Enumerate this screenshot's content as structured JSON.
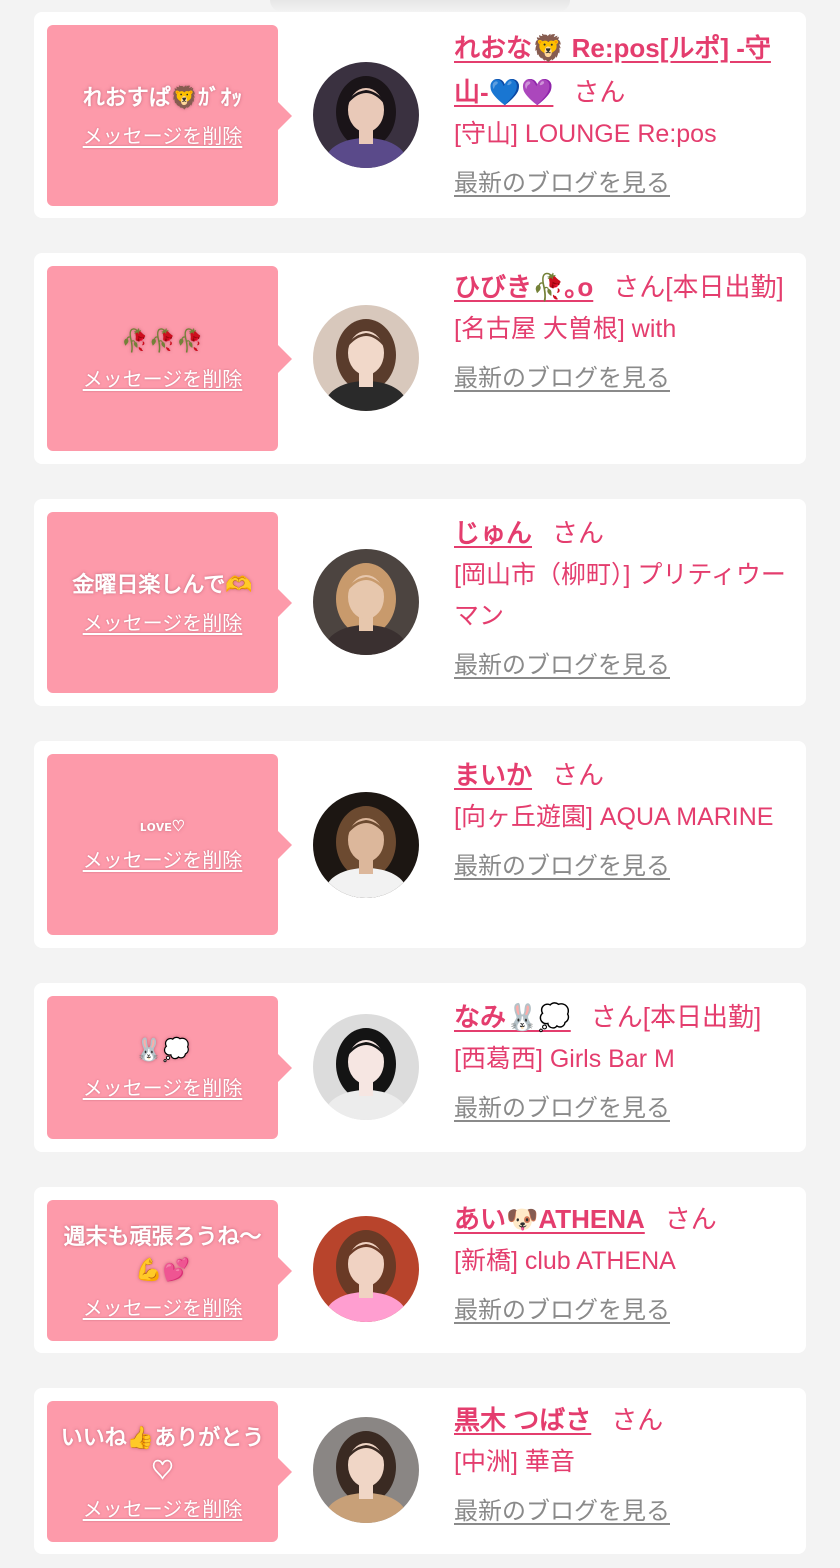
{
  "entries": [
    {
      "message": "れおすぱ🦁ｶﾞｵｯ",
      "delete_label": "メッセージを削除",
      "name": "れおな🦁 Re:pos[ルポ] -守山-💙💜",
      "honorific": "さん",
      "status": "",
      "shop": "[守山] LOUNGE Re:pos",
      "blog_label": "最新のブログを見る",
      "avatar_icon": "profile-photo-icon",
      "colors": {
        "bg": "#3a3140",
        "hair": "#1a1418",
        "skin": "#e9c9b8",
        "cloth": "#5a4a8a"
      }
    },
    {
      "message": "🥀🥀🥀",
      "delete_label": "メッセージを削除",
      "name": "ひびき🥀｡o",
      "honorific": "さん",
      "status": "[本日出勤]",
      "shop": "[名古屋 大曽根] with",
      "blog_label": "最新のブログを見る",
      "avatar_icon": "profile-photo-icon",
      "colors": {
        "bg": "#d8c8bc",
        "hair": "#5a3c2c",
        "skin": "#f1d8c9",
        "cloth": "#2a2a2a"
      }
    },
    {
      "message": "金曜日楽しんで🫶",
      "delete_label": "メッセージを削除",
      "name": "じゅん",
      "honorific": "さん",
      "status": "",
      "shop": "[岡山市（柳町）] プリティウーマン",
      "blog_label": "最新のブログを見る",
      "avatar_icon": "profile-photo-icon",
      "colors": {
        "bg": "#4c4440",
        "hair": "#c89a6c",
        "skin": "#e7c7ad",
        "cloth": "#3a3030"
      }
    },
    {
      "message": "ʟᴏᴠᴇ♡",
      "delete_label": "メッセージを削除",
      "name": "まいか",
      "honorific": "さん",
      "status": "",
      "shop": "[向ヶ丘遊園] AQUA MARINE",
      "blog_label": "最新のブログを見る",
      "avatar_icon": "profile-photo-icon",
      "colors": {
        "bg": "#1c1612",
        "hair": "#6c4a30",
        "skin": "#dcb79b",
        "cloth": "#f2f2f2"
      }
    },
    {
      "message": "🐰💭",
      "delete_label": "メッセージを削除",
      "name": "なみ🐰💭",
      "honorific": "さん",
      "status": "[本日出勤]",
      "shop": "[西葛西] Girls Bar M",
      "blog_label": "最新のブログを見る",
      "avatar_icon": "profile-photo-icon",
      "colors": {
        "bg": "#dcdcdc",
        "hair": "#141414",
        "skin": "#f6e6e2",
        "cloth": "#ececec"
      }
    },
    {
      "message": "週末も頑張ろうね〜💪💕",
      "delete_label": "メッセージを削除",
      "name": "あい🐶ATHENA",
      "honorific": "さん",
      "status": "",
      "shop": "[新橋] club ATHENA",
      "blog_label": "最新のブログを見る",
      "avatar_icon": "profile-photo-icon",
      "colors": {
        "bg": "#b8442c",
        "hair": "#6a3a26",
        "skin": "#f0d2c2",
        "cloth": "#ff9ed0"
      }
    },
    {
      "message": "いいね👍ありがとう♡",
      "delete_label": "メッセージを削除",
      "name": "黒木 つばさ",
      "honorific": "さん",
      "status": "",
      "shop": "[中洲] 華音",
      "blog_label": "最新のブログを見る",
      "avatar_icon": "profile-photo-icon",
      "colors": {
        "bg": "#8a8684",
        "hair": "#3a2a22",
        "skin": "#f0d6c6",
        "cloth": "#c8a078"
      }
    }
  ]
}
